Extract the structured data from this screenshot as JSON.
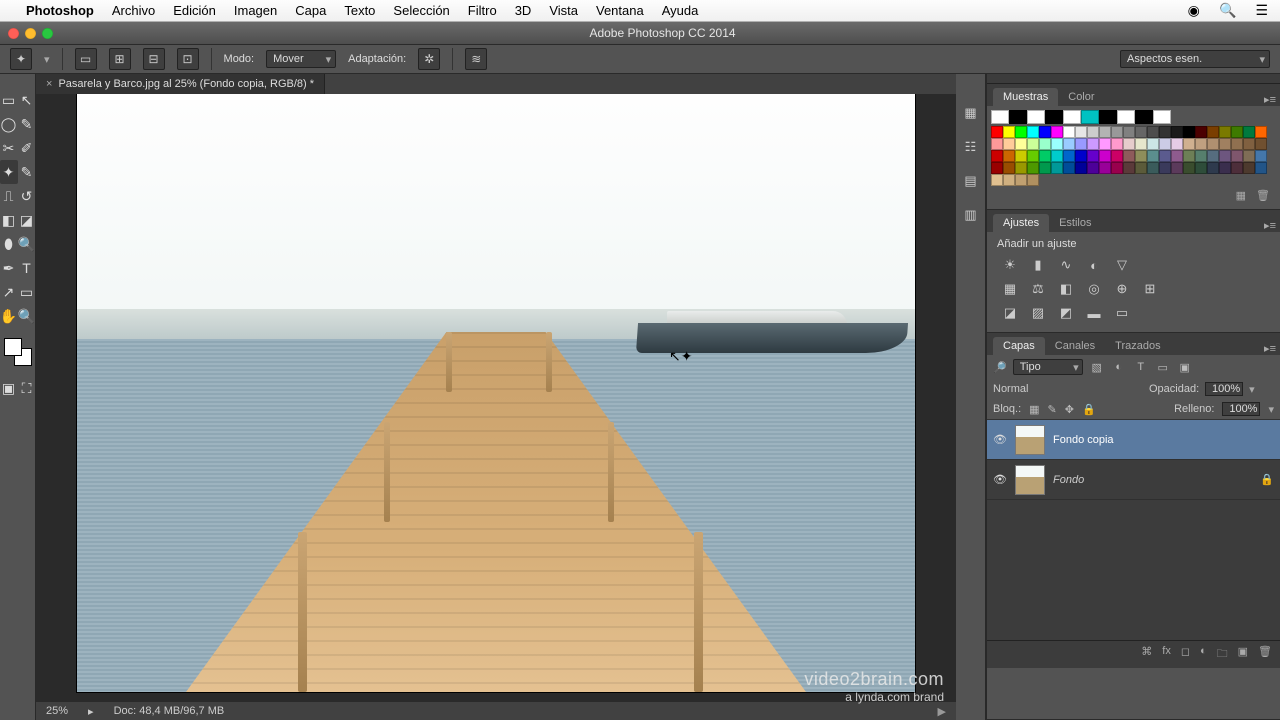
{
  "macmenu": {
    "appname": "Photoshop",
    "items": [
      "Archivo",
      "Edición",
      "Imagen",
      "Capa",
      "Texto",
      "Selección",
      "Filtro",
      "3D",
      "Vista",
      "Ventana",
      "Ayuda"
    ]
  },
  "window": {
    "title": "Adobe Photoshop CC 2014"
  },
  "options": {
    "mode_label": "Modo:",
    "mode_value": "Mover",
    "adapt_label": "Adaptación:",
    "workspace": "Aspectos esen."
  },
  "document": {
    "tab_title": "Pasarela y Barco.jpg al 25% (Fondo copia, RGB/8) *",
    "zoom": "25%",
    "status": "Doc: 48,4 MB/96,7 MB"
  },
  "panels": {
    "swatches_tab": "Muestras",
    "color_tab": "Color",
    "adjustments_tab": "Ajustes",
    "styles_tab": "Estilos",
    "add_adjustment": "Añadir un ajuste",
    "layers_tab": "Capas",
    "channels_tab": "Canales",
    "paths_tab": "Trazados",
    "filter_kind": "Tipo",
    "blend_mode": "Normal",
    "opacity_label": "Opacidad:",
    "opacity_value": "100%",
    "lock_label": "Bloq.:",
    "fill_label": "Relleno:",
    "fill_value": "100%",
    "layers": [
      {
        "name": "Fondo copia",
        "selected": true,
        "locked": false
      },
      {
        "name": "Fondo",
        "selected": false,
        "locked": true
      }
    ]
  },
  "swatch_colors_top": [
    "#ffffff",
    "#000000",
    "#ffffff",
    "#000000",
    "#ffffff",
    "#00c2c2",
    "#000000",
    "#ffffff",
    "#000000",
    "#ffffff"
  ],
  "swatch_colors": [
    "#ff0000",
    "#ffff00",
    "#00ff00",
    "#00ffff",
    "#0000ff",
    "#ff00ff",
    "#ffffff",
    "#e6e6e6",
    "#cccccc",
    "#b3b3b3",
    "#999999",
    "#808080",
    "#666666",
    "#4d4d4d",
    "#333333",
    "#1a1a1a",
    "#000000",
    "#4b0000",
    "#7a3e00",
    "#7a7a00",
    "#3e7a00",
    "#007a3e",
    "#ff6600",
    "#ff9999",
    "#ffcc99",
    "#ffff99",
    "#ccff99",
    "#99ffcc",
    "#99ffff",
    "#99ccff",
    "#9999ff",
    "#cc99ff",
    "#ff99ff",
    "#ff99cc",
    "#e6cccc",
    "#e6e6cc",
    "#cce6e6",
    "#cccce6",
    "#e6cce6",
    "#d0b090",
    "#c0a080",
    "#b09070",
    "#a08060",
    "#907050",
    "#806040",
    "#705030",
    "#cc0000",
    "#cc6600",
    "#cccc00",
    "#66cc00",
    "#00cc66",
    "#00cccc",
    "#0066cc",
    "#0000cc",
    "#6600cc",
    "#cc00cc",
    "#cc0066",
    "#8e5b5b",
    "#8e8e5b",
    "#5b8e8e",
    "#5b5b8e",
    "#8e5b8e",
    "#6d7f56",
    "#567f6d",
    "#566d7f",
    "#6d567f",
    "#7f566d",
    "#7f6d56",
    "#4477aa",
    "#990000",
    "#994d00",
    "#999900",
    "#4d9900",
    "#00994d",
    "#009999",
    "#004d99",
    "#000099",
    "#4d0099",
    "#990099",
    "#99004d",
    "#5b3a3a",
    "#5b5b3a",
    "#3a5b5b",
    "#3a3a5b",
    "#5b3a5b",
    "#3a4d2e",
    "#2e4d3a",
    "#2e3a4d",
    "#3a2e4d",
    "#4d2e3a",
    "#4d3a2e",
    "#225588",
    "#e0c090",
    "#d0b080",
    "#c0a070",
    "#b09060"
  ],
  "watermark": {
    "line1": "video2brain.com",
    "line2": "a lynda.com brand"
  }
}
